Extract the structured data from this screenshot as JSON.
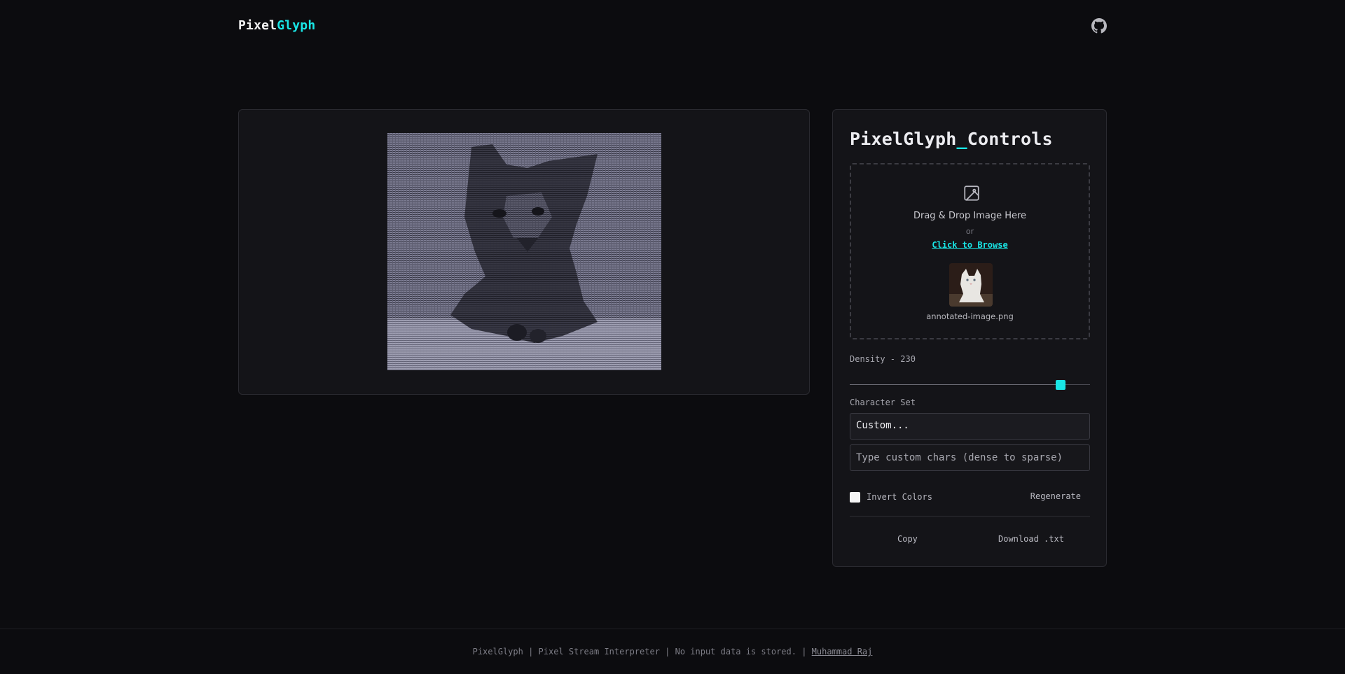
{
  "header": {
    "brand_part1": "Pixel",
    "brand_part2": "Glyph",
    "github_icon": "github-icon"
  },
  "preview": {
    "ascii_art_description_icon": "ascii-cat-render"
  },
  "controls": {
    "title_part1": "PixelGlyph",
    "title_part2": "_",
    "title_part3": "Controls",
    "dropzone": {
      "icon": "image-icon",
      "title": "Drag & Drop Image Here",
      "or": "or",
      "browse": "Click to Browse",
      "filename": "annotated-image.png"
    },
    "density": {
      "label": "Density - 230",
      "value": 230,
      "level_fraction": 0.895
    },
    "charset": {
      "label": "Character Set",
      "selected": "Custom...",
      "custom_placeholder": "Type custom chars (dense to sparse)"
    },
    "invert_label": "Invert Colors",
    "invert_checked": false,
    "regenerate": "Regenerate",
    "copy": "Copy",
    "download": "Download .txt"
  },
  "footer": {
    "text": "PixelGlyph | Pixel Stream Interpreter | No input data is stored. | ",
    "author": "Muhammad Raj"
  },
  "colors": {
    "accent": "#19e6e6",
    "background": "#0c0c0f",
    "panel": "#141418"
  }
}
